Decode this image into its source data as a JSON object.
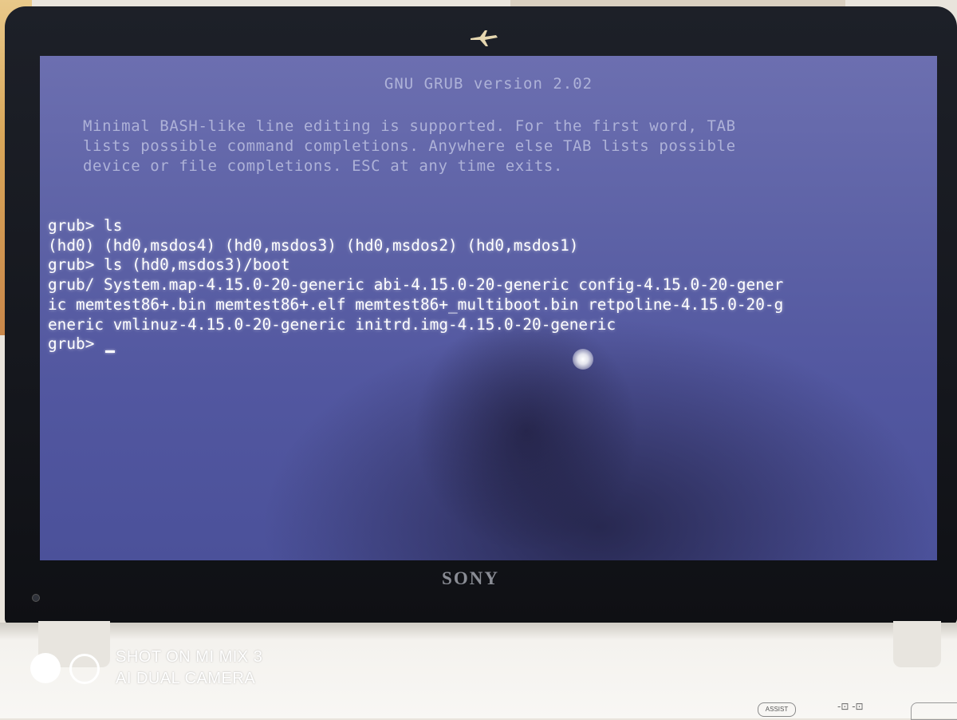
{
  "grub": {
    "title": "GNU GRUB  version 2.02",
    "help_lines": [
      "Minimal BASH-like line editing is supported. For the first word, TAB",
      "lists possible command completions. Anywhere else TAB lists possible",
      "device or file completions. ESC at any time exits."
    ],
    "console_lines": [
      "grub> ls",
      "(hd0) (hd0,msdos4) (hd0,msdos3) (hd0,msdos2) (hd0,msdos1)",
      "grub> ls (hd0,msdos3)/boot",
      "grub/ System.map-4.15.0-20-generic abi-4.15.0-20-generic config-4.15.0-20-gener",
      "ic memtest86+.bin memtest86+.elf memtest86+_multiboot.bin retpoline-4.15.0-20-g",
      "eneric vmlinuz-4.15.0-20-generic initrd.img-4.15.0-20-generic"
    ],
    "prompt": "grub> "
  },
  "laptop": {
    "brand": "SONY",
    "assist_label": "ASSIST",
    "lock_icons": "-⊡ -⊡"
  },
  "watermark": {
    "line1": "SHOT ON MI MIX 3",
    "line2": "AI DUAL CAMERA"
  }
}
